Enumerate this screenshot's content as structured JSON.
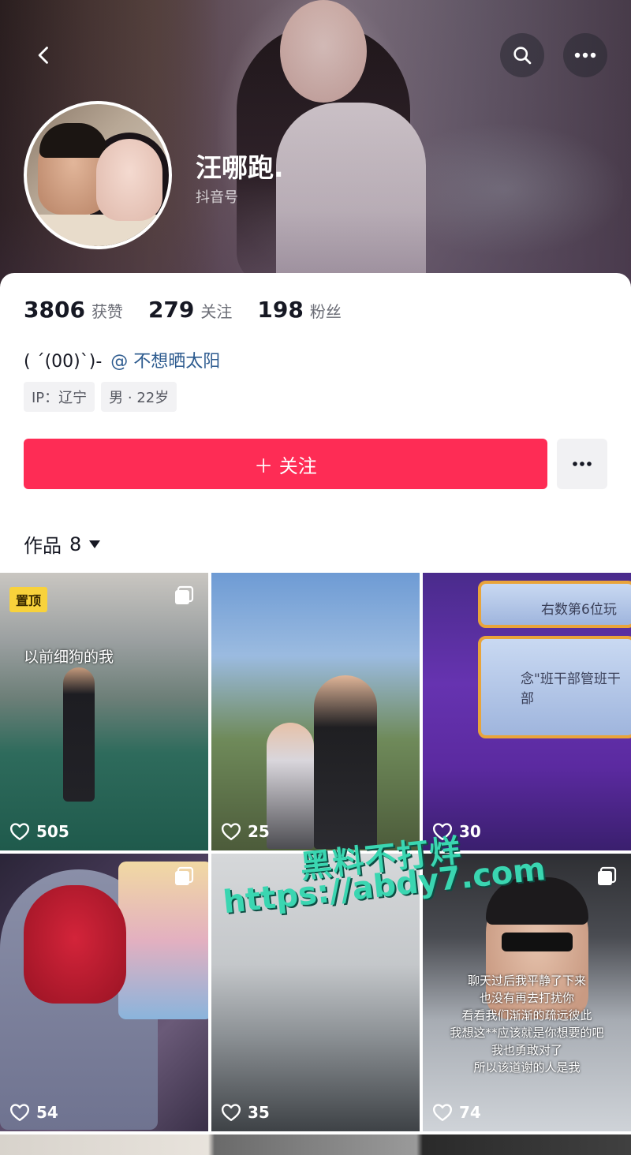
{
  "header": {
    "nickname": "汪哪跑.",
    "douyin_id_label": "抖音号"
  },
  "stats": [
    {
      "value": "3806",
      "label": "获赞"
    },
    {
      "value": "279",
      "label": "关注"
    },
    {
      "value": "198",
      "label": "粉丝"
    }
  ],
  "bio": {
    "text": "( ´(00)`)- ",
    "mention": "@ 不想晒太阳"
  },
  "tags": [
    "IP：辽宁",
    "男 · 22岁"
  ],
  "actions": {
    "follow_label": "＋ 关注"
  },
  "works": {
    "label": "作品",
    "count": "8"
  },
  "grid": [
    {
      "likes": "505",
      "pinned_label": "置顶",
      "caption": "以前细狗的我"
    },
    {
      "likes": "25"
    },
    {
      "likes": "30",
      "text1": "右数第6位玩",
      "text2": "念\"班干部管班干部"
    },
    {
      "likes": "54"
    },
    {
      "likes": "35"
    },
    {
      "likes": "74",
      "caption_lines": [
        "聊天过后我平静了下来",
        "也没有再去打扰你",
        "看看我们渐渐的疏远彼此",
        "我想这**应该就是你想要的吧",
        "我也勇敢对了",
        "所以该道谢的人是我"
      ]
    }
  ],
  "watermark": {
    "line1": "黑料不打烊",
    "line2": "https://abdy7.com"
  },
  "colors": {
    "follow_button": "#fe2c55",
    "mention": "#2d5b8f",
    "pin_badge": "#f8d23b",
    "watermark": "#3ad6b1"
  }
}
